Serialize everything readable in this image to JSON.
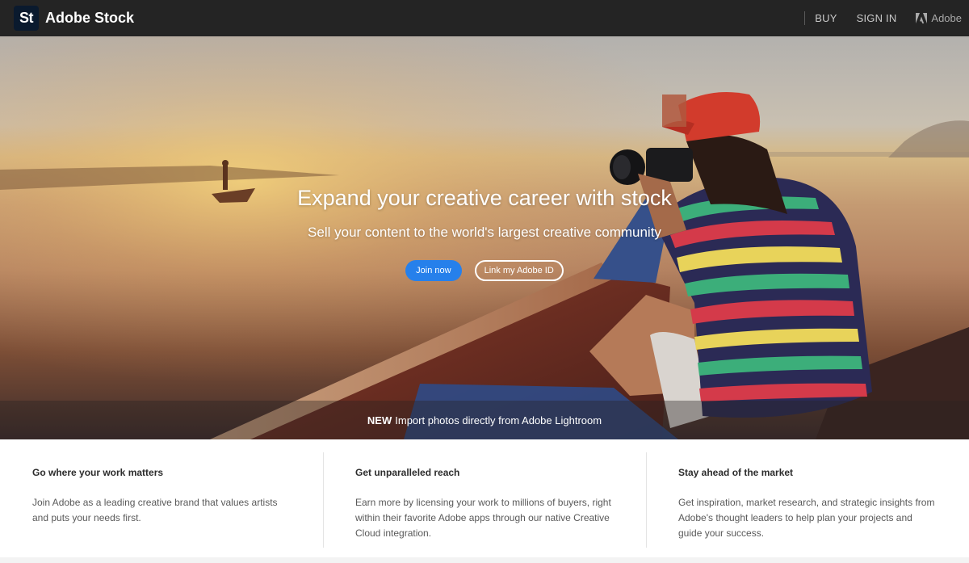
{
  "nav": {
    "logo_text": "St",
    "brand_name": "Adobe Stock",
    "buy_label": "BUY",
    "signin_label": "SIGN IN",
    "adobe_label": "Adobe",
    "adobe_icon": "adobe-logo-icon"
  },
  "hero": {
    "title": "Expand your creative career with stock",
    "subtitle": "Sell your content to the world's largest creative community",
    "join_button": "Join now",
    "link_button": "Link my Adobe ID",
    "banner_tag": "NEW",
    "banner_text": "Import photos directly from Adobe Lightroom"
  },
  "features": [
    {
      "title": "Go where your work matters",
      "body": "Join Adobe as a leading creative brand that values artists and puts your needs first."
    },
    {
      "title": "Get unparalleled reach",
      "body": "Earn more by licensing your work to millions of buyers, right within their favorite Adobe apps through our native Creative Cloud integration."
    },
    {
      "title": "Stay ahead of the market",
      "body": "Get inspiration, market research, and strategic insights from Adobe's thought leaders to help plan your projects and guide your success."
    }
  ],
  "colors": {
    "nav_bg": "#242424",
    "accent": "#2680eb",
    "logo_bg": "#0a1a2e"
  }
}
